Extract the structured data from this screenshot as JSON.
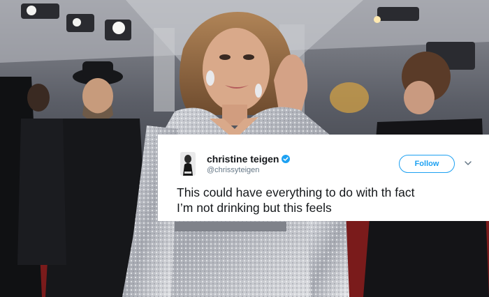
{
  "tweet": {
    "display_name": "christine teigen",
    "handle": "@chrissyteigen",
    "follow_label": "Follow",
    "text_lines": [
      "This could have everything to do with th fact",
      "I’m not drinking but this feels"
    ]
  },
  "colors": {
    "accent": "#1da1f2",
    "card_background": "#ffffff",
    "text_primary": "#14171a",
    "text_secondary": "#657786"
  },
  "icons": {
    "verified": "verified-badge-icon",
    "menu": "chevron-down-icon"
  }
}
